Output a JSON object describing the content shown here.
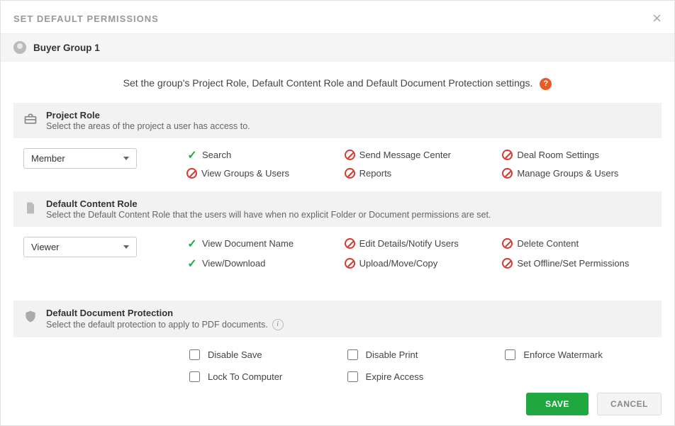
{
  "dialog_title": "SET DEFAULT PERMISSIONS",
  "group_name": "Buyer Group 1",
  "intro_text": "Set the group's Project Role, Default Content Role and Default Document Protection settings.",
  "sections": {
    "project_role": {
      "title": "Project Role",
      "desc": "Select the areas of the project a user has access to.",
      "selected": "Member",
      "permissions": [
        {
          "label": "Search",
          "allowed": true
        },
        {
          "label": "Send Message Center",
          "allowed": false
        },
        {
          "label": "Deal Room Settings",
          "allowed": false
        },
        {
          "label": "View Groups & Users",
          "allowed": false
        },
        {
          "label": "Reports",
          "allowed": false
        },
        {
          "label": "Manage Groups & Users",
          "allowed": false
        }
      ]
    },
    "content_role": {
      "title": "Default Content Role",
      "desc": "Select the Default Content Role that the users will have when no explicit Folder or Document permissions are set.",
      "selected": "Viewer",
      "permissions": [
        {
          "label": "View Document Name",
          "allowed": true
        },
        {
          "label": "Edit Details/Notify Users",
          "allowed": false
        },
        {
          "label": "Delete Content",
          "allowed": false
        },
        {
          "label": "View/Download",
          "allowed": true
        },
        {
          "label": "Upload/Move/Copy",
          "allowed": false
        },
        {
          "label": "Set Offline/Set Permissions",
          "allowed": false
        }
      ]
    },
    "doc_protection": {
      "title": "Default Document Protection",
      "desc": "Select the default protection to apply to PDF documents.",
      "options": [
        {
          "label": "Disable Save",
          "checked": false
        },
        {
          "label": "Disable Print",
          "checked": false
        },
        {
          "label": "Enforce Watermark",
          "checked": false
        },
        {
          "label": "Lock To Computer",
          "checked": false
        },
        {
          "label": "Expire Access",
          "checked": false
        }
      ]
    }
  },
  "buttons": {
    "save": "SAVE",
    "cancel": "CANCEL"
  }
}
